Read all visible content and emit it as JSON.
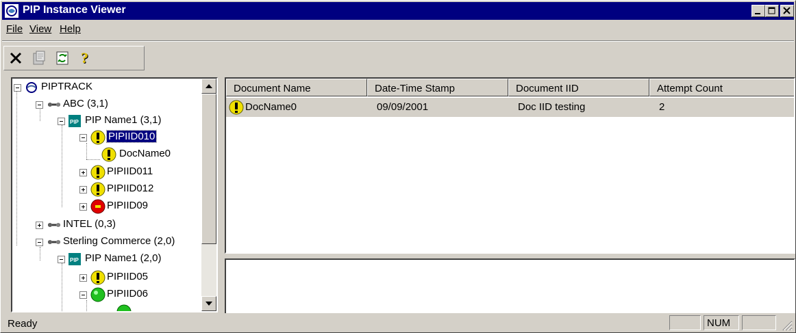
{
  "window": {
    "title": "PIP Instance Viewer"
  },
  "menu": [
    {
      "label": "File"
    },
    {
      "label": "View"
    },
    {
      "label": "Help"
    }
  ],
  "toolbar": {
    "icons": [
      "delete-icon",
      "properties-icon",
      "refresh-icon",
      "help-icon"
    ]
  },
  "tree": {
    "root": "PIPTRACK",
    "nodes": [
      {
        "label": "ABC (3,1)"
      },
      {
        "label": "PIP Name1 (3,1)"
      },
      {
        "label": "PIPIID010"
      },
      {
        "label": "DocName0"
      },
      {
        "label": "PIPIID011"
      },
      {
        "label": "PIPIID012"
      },
      {
        "label": "PIPIID09"
      },
      {
        "label": "INTEL (0,3)"
      },
      {
        "label": "Sterling Commerce (2,0)"
      },
      {
        "label": "PIP Name1 (2,0)"
      },
      {
        "label": "PIPIID05"
      },
      {
        "label": "PIPIID06"
      }
    ]
  },
  "list": {
    "columns": [
      "Document Name",
      "Date-Time Stamp",
      "Document IID",
      "Attempt Count"
    ],
    "rows": [
      {
        "name": "DocName0",
        "date": "09/09/2001",
        "iid": "Doc IID testing",
        "attempts": "2"
      }
    ]
  },
  "status": {
    "text": "Ready",
    "num": "NUM"
  },
  "colors": {
    "titlebar": "#000080",
    "warning": "#f0e000",
    "error": "#e00000",
    "ok": "#20c020"
  }
}
